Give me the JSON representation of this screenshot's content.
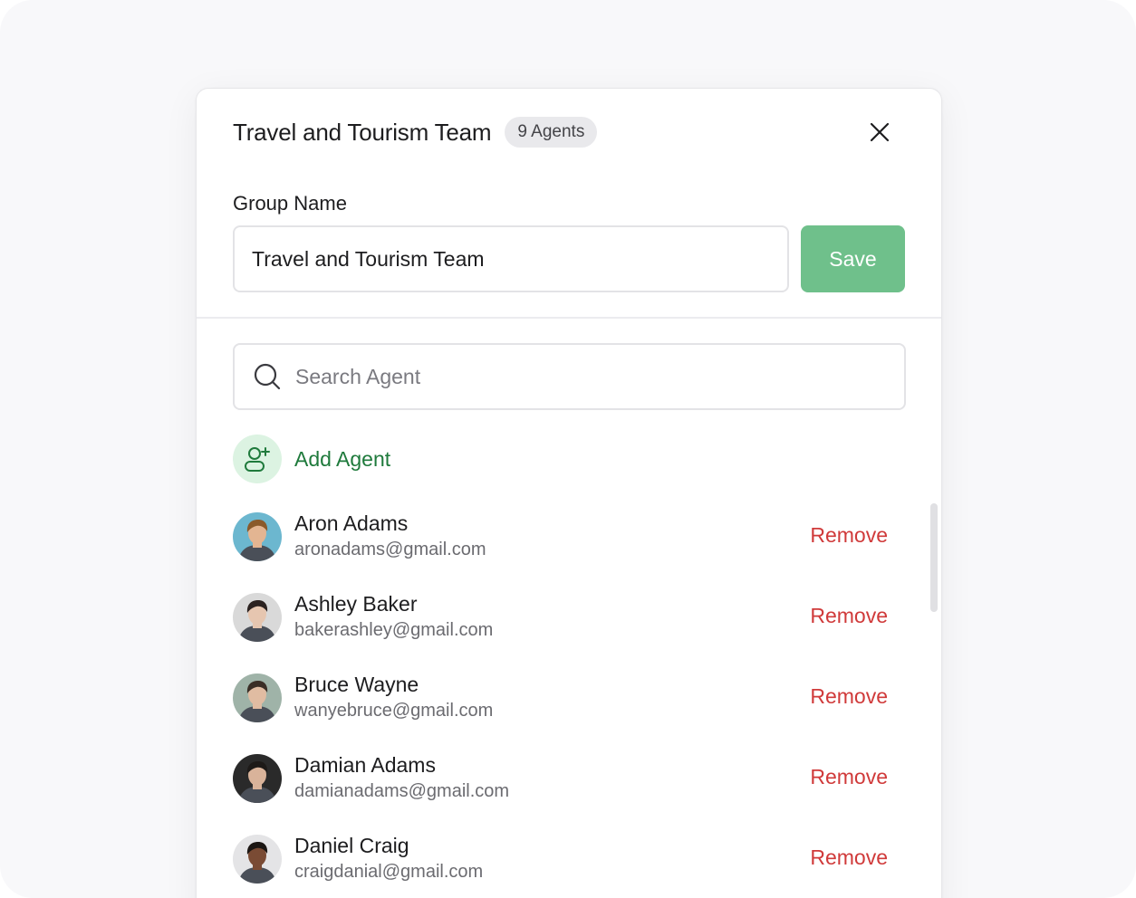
{
  "modal": {
    "title": "Travel and Tourism Team",
    "badge": "9 Agents",
    "close_icon": "close-icon"
  },
  "group_name": {
    "label": "Group Name",
    "value": "Travel and Tourism Team",
    "save_label": "Save"
  },
  "search": {
    "placeholder": "Search Agent",
    "icon": "search-icon"
  },
  "add_agent": {
    "label": "Add Agent",
    "icon": "add-user-icon"
  },
  "agents": [
    {
      "name": "Aron Adams",
      "email": "aronadams@gmail.com",
      "action": "Remove",
      "avatar_bg": "#6cb7cf",
      "avatar_skin": "#e3b592",
      "avatar_hair": "#8a5a2b"
    },
    {
      "name": "Ashley Baker",
      "email": "bakerashley@gmail.com",
      "action": "Remove",
      "avatar_bg": "#d9d9d9",
      "avatar_skin": "#e6c6b0",
      "avatar_hair": "#2b2220"
    },
    {
      "name": "Bruce Wayne",
      "email": "wanyebruce@gmail.com",
      "action": "Remove",
      "avatar_bg": "#9fb3a8",
      "avatar_skin": "#e0bca2",
      "avatar_hair": "#3a2e26"
    },
    {
      "name": "Damian Adams",
      "email": "damianadams@gmail.com",
      "action": "Remove",
      "avatar_bg": "#2a2a2a",
      "avatar_skin": "#d9b39a",
      "avatar_hair": "#1d1a18"
    },
    {
      "name": "Daniel Craig",
      "email": "craigdanial@gmail.com",
      "action": "Remove",
      "avatar_bg": "#e4e4e6",
      "avatar_skin": "#7a4b34",
      "avatar_hair": "#1b1613"
    }
  ],
  "colors": {
    "save": "#6fc08b",
    "remove": "#d03a3a",
    "add_agent": "#1f7a3c"
  }
}
